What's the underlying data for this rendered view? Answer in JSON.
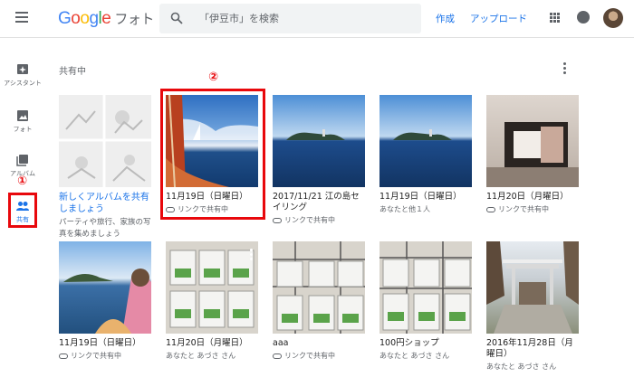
{
  "header": {
    "logo": {
      "g": "G",
      "o1": "o",
      "o2": "o",
      "g2": "g",
      "l": "l",
      "e": "e",
      "product": "フォト"
    },
    "search_placeholder": "「伊豆市」を検索",
    "create_label": "作成",
    "upload_label": "アップロード"
  },
  "sidebar": {
    "items": [
      {
        "label": "アシスタント",
        "icon": "assistant-icon"
      },
      {
        "label": "フォト",
        "icon": "photo-icon"
      },
      {
        "label": "アルバム",
        "icon": "album-icon"
      },
      {
        "label": "共有",
        "icon": "people-icon",
        "active": true
      }
    ]
  },
  "annotations": {
    "one": "①",
    "two": "②",
    "color": "#e8080c"
  },
  "main": {
    "section_title": "共有中",
    "new_album": {
      "title": "新しくアルバムを共有しましょう",
      "subtitle": "パーティや旅行、家族の写真を集めましょう"
    },
    "cards": [
      {
        "title": "11月19日（日曜日）",
        "subtitle": "リンクで共有中",
        "link_icon": true
      },
      {
        "title": "2017/11/21 江の島セイリング",
        "subtitle": "リンクで共有中",
        "link_icon": true
      },
      {
        "title": "11月19日（日曜日）",
        "subtitle": "あなたと他１人",
        "link_icon": false
      },
      {
        "title": "11月20日（月曜日）",
        "subtitle": "リンクで共有中",
        "link_icon": true
      },
      {
        "title": "11月19日（日曜日）",
        "subtitle": "リンクで共有中",
        "link_icon": true
      },
      {
        "title": "11月20日（月曜日）",
        "subtitle": "あなたと あづさ さん",
        "link_icon": false
      },
      {
        "title": "aaa",
        "subtitle": "リンクで共有中",
        "link_icon": true
      },
      {
        "title": "100円ショップ",
        "subtitle": "あなたと あづさ さん",
        "link_icon": false
      },
      {
        "title": "2016年11月28日（月曜日）",
        "subtitle": "あなたと あづさ さん",
        "link_icon": false
      }
    ]
  },
  "colors": {
    "accent": "#1a73e8",
    "annotation": "#e8080c"
  }
}
